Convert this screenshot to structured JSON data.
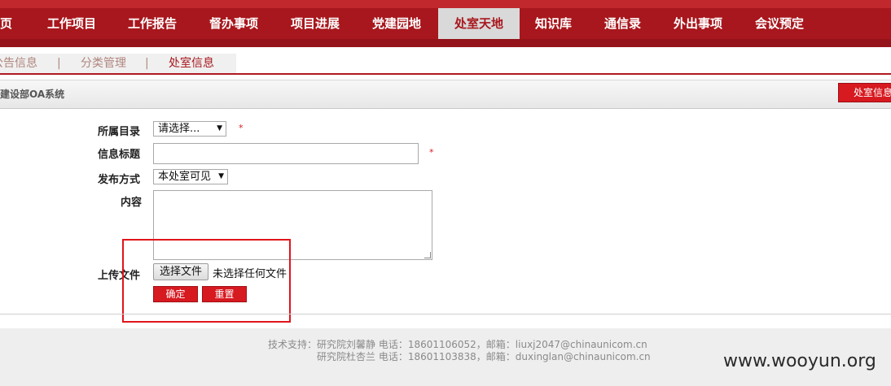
{
  "nav": {
    "items": [
      "页",
      "工作项目",
      "工作报告",
      "督办事项",
      "项目进展",
      "党建园地",
      "处室天地",
      "知识库",
      "通信录",
      "外出事项",
      "会议预定"
    ],
    "active": "处室天地"
  },
  "subtabs": {
    "items": [
      "公告信息",
      "分类管理",
      "处室信息"
    ],
    "separator": "|",
    "active": "处室信息"
  },
  "titlebar": {
    "title": "建设部OA系统",
    "right_button": "处室信息"
  },
  "form": {
    "category_label": "所属目录",
    "category_value": "请选择...",
    "title_label": "信息标题",
    "title_value": "",
    "publish_label": "发布方式",
    "publish_value": "本处室可见",
    "content_label": "内容",
    "upload_label": "上传文件",
    "choose_file_button": "选择文件",
    "no_file_text": "未选择任何文件",
    "confirm_button": "确定",
    "reset_button": "重置",
    "required_mark": "*"
  },
  "footer": {
    "line1": "技术支持：研究院刘馨静 电话：18601106052，邮箱：liuxj2047@chinaunicom.cn",
    "line2": "研究院杜杏兰 电话：18601103838，邮箱：duxinglan@chinaunicom.cn"
  },
  "watermark": "www.wooyun.org",
  "colors": {
    "nav_bg": "#a8171d",
    "accent_red": "#d71920",
    "annotation_red": "#e0151b"
  }
}
